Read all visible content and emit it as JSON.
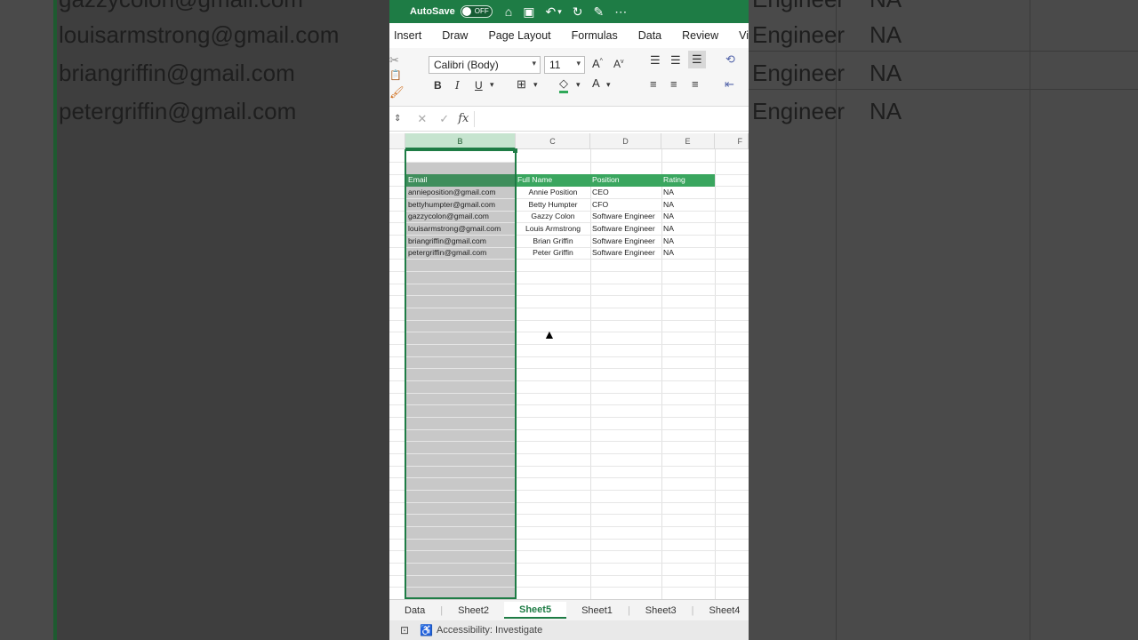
{
  "background_left": {
    "emails": [
      "gazzycolon@gmail.com",
      "louisarmstrong@gmail.com",
      "briangriffin@gmail.com",
      "petergriffin@gmail.com"
    ]
  },
  "background_right": {
    "positions": [
      "Engineer",
      "Engineer",
      "Engineer",
      "Engineer"
    ],
    "ratings": [
      "NA",
      "NA",
      "NA",
      "NA"
    ]
  },
  "titlebar": {
    "autosave_label": "AutoSave",
    "toggle_state": "OFF"
  },
  "ribbon_tabs": [
    "Insert",
    "Draw",
    "Page Layout",
    "Formulas",
    "Data",
    "Review",
    "Vie"
  ],
  "ribbon": {
    "font_name": "Calibri (Body)",
    "font_size": "11",
    "bold": "B",
    "italic": "I",
    "underline": "U"
  },
  "formula_bar": {
    "fx": "fx",
    "value": ""
  },
  "columns": [
    "B",
    "C",
    "D",
    "E",
    "F"
  ],
  "table": {
    "headers": [
      "Email",
      "Full Name",
      "Position",
      "Rating"
    ],
    "rows": [
      [
        "annieposition@gmail.com",
        "Annie Position",
        "CEO",
        "NA"
      ],
      [
        "bettyhumpter@gmail.com",
        "Betty Humpter",
        "CFO",
        "NA"
      ],
      [
        "gazzycolon@gmail.com",
        "Gazzy Colon",
        "Software Engineer",
        "NA"
      ],
      [
        "louisarmstrong@gmail.com",
        "Louis Armstrong",
        "Software Engineer",
        "NA"
      ],
      [
        "briangriffin@gmail.com",
        "Brian Griffin",
        "Software Engineer",
        "NA"
      ],
      [
        "petergriffin@gmail.com",
        "Peter Griffin",
        "Software Engineer",
        "NA"
      ]
    ]
  },
  "sheet_tabs": [
    "Data",
    "Sheet2",
    "Sheet5",
    "Sheet1",
    "Sheet3",
    "Sheet4"
  ],
  "active_sheet": "Sheet5",
  "statusbar": {
    "accessibility": "Accessibility: Investigate"
  },
  "colors": {
    "excel_green": "#1e7c45",
    "header_green": "#3aa65f"
  }
}
